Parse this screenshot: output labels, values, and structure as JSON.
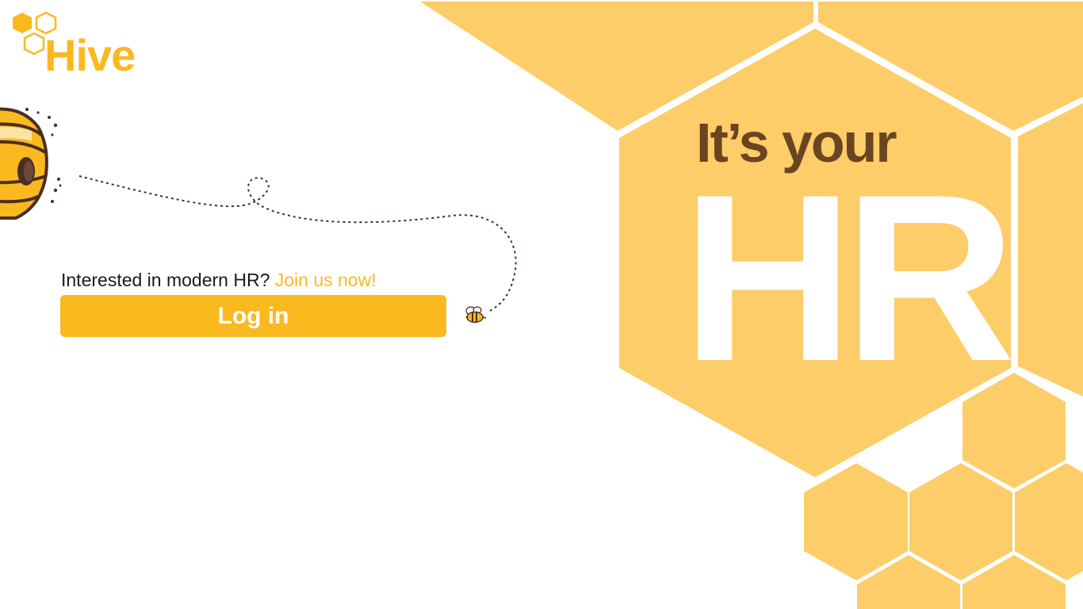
{
  "brand": {
    "name": "Hive",
    "color": "#fbb920"
  },
  "login_panel": {
    "prompt_text": "Interested in modern HR?",
    "join_link_label": "Join us now!",
    "login_button_label": "Log in"
  },
  "hero": {
    "tagline": "It’s your",
    "headline": "HR",
    "panel_color": "#fdcd69",
    "tagline_color": "#6b4421"
  },
  "icons": {
    "logo": "honeycomb-logo-icon",
    "hive": "beehive-illustration-icon",
    "bee": "bee-icon",
    "path": "dotted-flight-path"
  }
}
